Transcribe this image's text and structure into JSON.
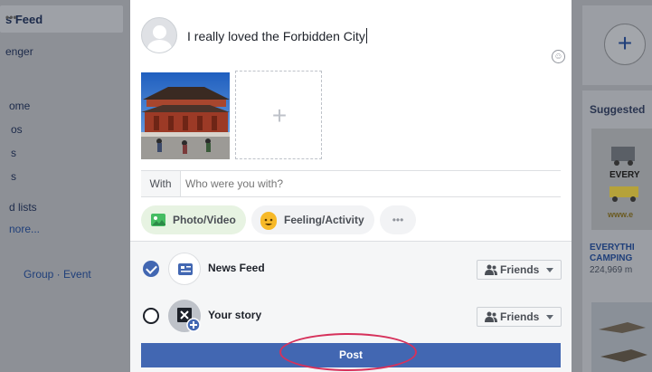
{
  "background_left": {
    "feed_title": "s Feed",
    "feed_more": "•••",
    "nav_items": [
      "enger",
      "ome",
      "os",
      "s",
      "s",
      "d lists"
    ],
    "see_more": "nore...",
    "create_links": "Group · Event"
  },
  "background_right": {
    "plus": "+",
    "suggested": "Suggested",
    "ad_image_text": "EVERY",
    "ad_image_url": "www.e",
    "ad_title": "EVERYTHI\nCAMPING",
    "ad_sub": "224,969 m"
  },
  "composer": {
    "text": "I really loved the Forbidden City",
    "emoji_icon": "smiley-icon",
    "add_photo_symbol": "+",
    "with_label": "With",
    "with_placeholder": "Who were you with?",
    "actions": {
      "photo": "Photo/Video",
      "feeling": "Feeling/Activity",
      "more": "•••"
    }
  },
  "share": {
    "news_feed": {
      "label": "News Feed",
      "checked": true,
      "audience": "Friends"
    },
    "story": {
      "label": "Your story",
      "checked": false,
      "audience": "Friends"
    }
  },
  "post_button": "Post",
  "colors": {
    "primary": "#4267b2",
    "highlight": "#d6315b",
    "photo_pill": "#e7f3e2"
  }
}
